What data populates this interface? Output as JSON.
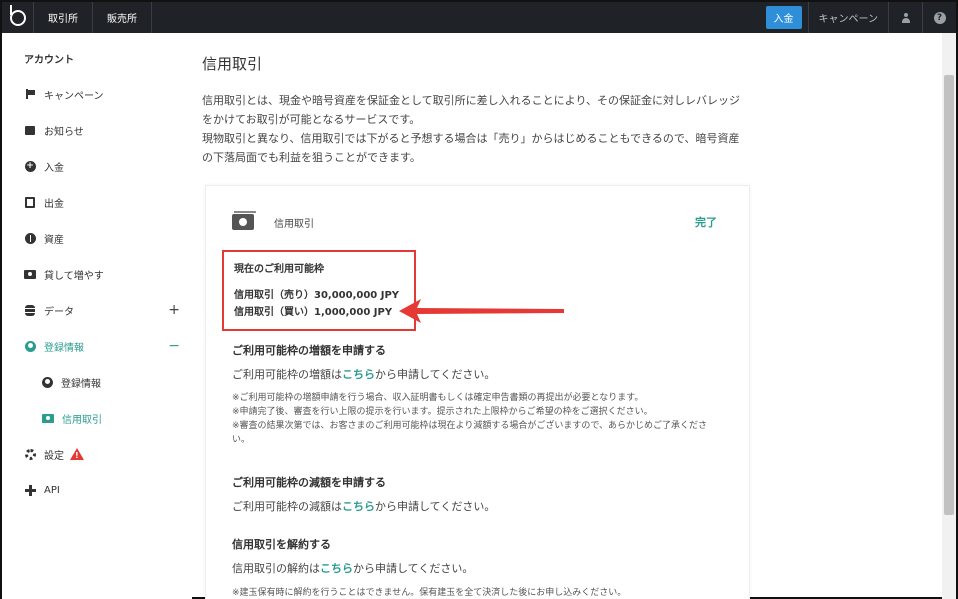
{
  "topbar": {
    "nav": [
      "取引所",
      "販売所"
    ],
    "deposit_label": "入金",
    "campaign_label": "キャンペーン"
  },
  "sidebar": {
    "heading": "アカウント",
    "items": [
      {
        "label": "キャンペーン",
        "icon": "flag-icon"
      },
      {
        "label": "お知らせ",
        "icon": "message-icon"
      },
      {
        "label": "入金",
        "icon": "plus-circle-icon"
      },
      {
        "label": "出金",
        "icon": "withdraw-icon"
      },
      {
        "label": "資産",
        "icon": "pie-icon"
      },
      {
        "label": "貸して増やす",
        "icon": "lend-icon"
      },
      {
        "label": "データ",
        "icon": "database-icon"
      },
      {
        "label": "登録情報",
        "icon": "user-circle-icon"
      },
      {
        "label": "設定",
        "icon": "gear-icon"
      },
      {
        "label": "API",
        "icon": "api-icon"
      }
    ],
    "sub_items": [
      {
        "label": "登録情報",
        "icon": "user-circle-icon"
      },
      {
        "label": "信用取引",
        "icon": "cash-icon"
      }
    ],
    "accent_color": "#2a9d8f",
    "warning_color": "#e53935"
  },
  "main": {
    "title": "信用取引",
    "intro": [
      "信用取引とは、現金や暗号資産を保証金として取引所に差し入れることにより、その保証金に対しレバレッジ",
      "をかけてお取引が可能となるサービスです。",
      "現物取引と異なり、信用取引では下がると予想する場合は「売り」からはじめることもできるので、暗号資産",
      "の下落局面でも利益を狙うことができます。"
    ],
    "card": {
      "label": "信用取引",
      "status": "完了",
      "limit_title": "現在のご利用可能枠",
      "limit_sell": "信用取引（売り）30,000,000 JPY",
      "limit_buy": "信用取引（買い）1,000,000 JPY",
      "increase_title": "ご利用可能枠の増額を申請する",
      "increase_text_pre": "ご利用可能枠の増額は",
      "increase_link": "こちら",
      "increase_text_post": "から申請してください。",
      "increase_notes": [
        "※ご利用可能枠の増額申請を行う場合、収入証明書もしくは確定申告書類の再提出が必要となります。",
        "※申請完了後、審査を行い上限の提示を行います。提示された上限枠からご希望の枠をご選択ください。",
        "※審査の結果次第では、お客さまのご利用可能枠は現在より減額する場合がございますので、あらかじめご了承くださ",
        "い。"
      ],
      "decrease_title": "ご利用可能枠の減額を申請する",
      "decrease_text_pre": "ご利用可能枠の減額は",
      "decrease_link": "こちら",
      "decrease_text_post": "から申請してください。",
      "cancel_title": "信用取引を解約する",
      "cancel_text_pre": "信用取引の解約は",
      "cancel_link": "こちら",
      "cancel_text_post": "から申請してください。",
      "cancel_note": "※建玉保有時に解約を行うことはできません。保有建玉を全て決済した後にお申し込みください。"
    }
  }
}
